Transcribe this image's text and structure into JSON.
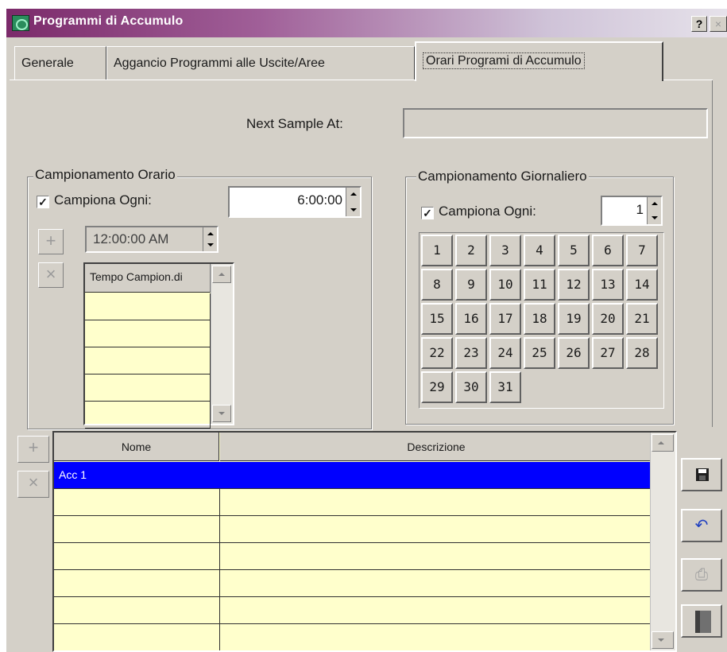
{
  "window": {
    "title": "Programmi di Accumulo",
    "help_label": "?",
    "close_label": "×"
  },
  "tabs": [
    {
      "label": "Generale",
      "active": false
    },
    {
      "label": "Aggancio Programmi alle Uscite/Aree",
      "active": false
    },
    {
      "label": "Orari Programi di Accumulo",
      "active": true
    }
  ],
  "next_sample": {
    "label": "Next Sample At:",
    "value": ""
  },
  "hourly": {
    "title": "Campionamento Orario",
    "checkbox_label": "Campiona Ogni:",
    "checked": true,
    "interval_value": "6:00:00",
    "time_value": "12:00:00 AM",
    "add_label": "+",
    "delete_label": "×",
    "list_header": "Tempo Campion.di",
    "list_rows": [
      "",
      "",
      "",
      "",
      ""
    ]
  },
  "daily": {
    "title": "Campionamento Giornaliero",
    "checkbox_label": "Campiona Ogni:",
    "checked": true,
    "interval_value": "1",
    "days": [
      "1",
      "2",
      "3",
      "4",
      "5",
      "6",
      "7",
      "8",
      "9",
      "10",
      "11",
      "12",
      "13",
      "14",
      "15",
      "16",
      "17",
      "18",
      "19",
      "20",
      "21",
      "22",
      "23",
      "24",
      "25",
      "26",
      "27",
      "28",
      "29",
      "30",
      "31"
    ]
  },
  "programs": {
    "add_label": "+",
    "delete_label": "×",
    "columns": [
      "Nome",
      "Descrizione"
    ],
    "rows": [
      {
        "nome": "Acc 1",
        "descrizione": "",
        "selected": true
      },
      {
        "nome": "",
        "descrizione": "",
        "selected": false
      },
      {
        "nome": "",
        "descrizione": "",
        "selected": false
      },
      {
        "nome": "",
        "descrizione": "",
        "selected": false
      },
      {
        "nome": "",
        "descrizione": "",
        "selected": false
      },
      {
        "nome": "",
        "descrizione": "",
        "selected": false
      },
      {
        "nome": "",
        "descrizione": "",
        "selected": false
      }
    ]
  },
  "side_buttons": [
    {
      "icon": "floppy-disk-icon"
    },
    {
      "icon": "undo-icon"
    },
    {
      "icon": "print-icon"
    },
    {
      "icon": "exit-door-icon"
    }
  ],
  "colors": {
    "window_bg": "#d4d0c8",
    "grid_bg": "#ffffcc",
    "selection": "#0000ff",
    "title_gradient_start": "#7b2a6a"
  }
}
